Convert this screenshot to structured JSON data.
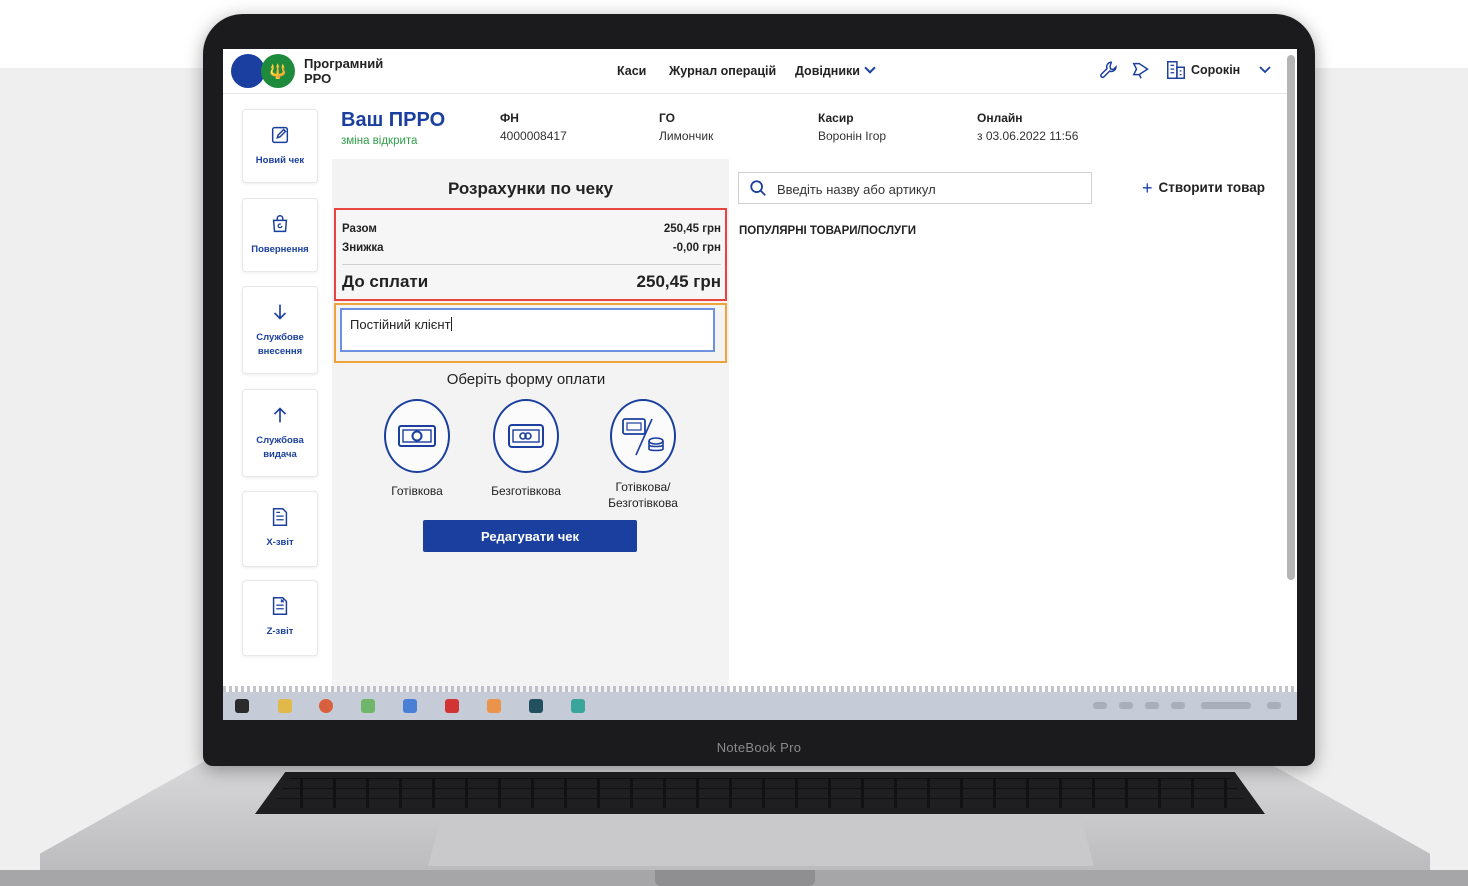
{
  "laptop": {
    "label": "NoteBook Pro"
  },
  "header": {
    "brand": "Програмний\nРРО",
    "nav": [
      {
        "label": "Каси"
      },
      {
        "label": "Журнал операцій"
      },
      {
        "label": "Довідники"
      }
    ],
    "user": "Сорокін"
  },
  "sidebar": {
    "items": [
      {
        "label": "Новий чек"
      },
      {
        "label": "Повернення"
      },
      {
        "label": "Службове внесення"
      },
      {
        "label": "Службова видача"
      },
      {
        "label": "Х-звіт"
      },
      {
        "label": "Z-звіт"
      }
    ]
  },
  "info": {
    "title": "Ваш ПРРО",
    "status": "зміна відкрита",
    "fn_label": "ФН",
    "fn_value": "4000008417",
    "go_label": "ГО",
    "go_value": "Лимончик",
    "cashier_label": "Касир",
    "cashier_value": "Воронін Ігор",
    "online_label": "Онлайн",
    "online_value": "з 03.06.2022 11:56"
  },
  "payment": {
    "title": "Розрахунки по чеку",
    "total_label": "Разом",
    "total_value": "250,45 грн",
    "discount_label": "Знижка",
    "discount_value": "-0,00 грн",
    "due_label": "До сплати",
    "due_value": "250,45 грн",
    "comment": "Постійний клієнт",
    "choose_label": "Оберіть форму оплати",
    "options": [
      {
        "label": "Готівкова"
      },
      {
        "label": "Безготівкова"
      },
      {
        "label": "Готівкова/\nБезготівкова"
      }
    ],
    "edit_button": "Редагувати чек"
  },
  "products": {
    "search_placeholder": "Введіть назву або артикул",
    "create_button": "Створити товар",
    "popular_label": "ПОПУЛЯРНІ ТОВАРИ/ПОСЛУГИ"
  },
  "colors": {
    "brand_blue": "#1a3f9e",
    "status_green": "#2f9d4a",
    "totals_border": "#e8433f",
    "comment_border": "#f0a33a"
  }
}
